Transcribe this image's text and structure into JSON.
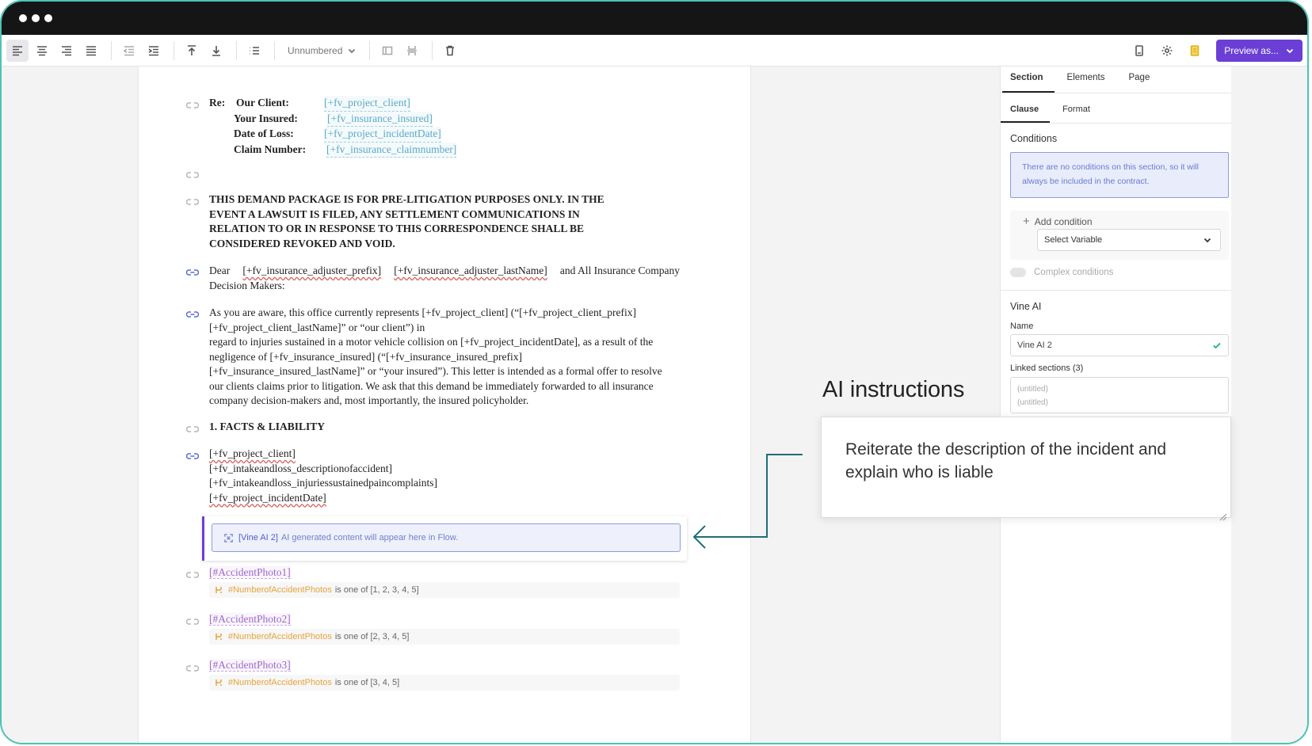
{
  "toolbar": {
    "numbering_label": "Unnumbered",
    "preview_label": "Preview as..."
  },
  "document": {
    "re": {
      "re_label": "Re:",
      "rows": [
        {
          "label": "Our Client:",
          "value": "[+fv_project_client]"
        },
        {
          "label": "Your Insured:",
          "value": "[+fv_insurance_insured]"
        },
        {
          "label": "Date of Loss:",
          "value": "[+fv_project_incidentDate]"
        },
        {
          "label": "Claim Number:",
          "value": "[+fv_insurance_claimnumber]"
        }
      ]
    },
    "disclaimer_lines": [
      "THIS DEMAND PACKAGE IS FOR PRE-LITIGATION PURPOSES ONLY. IN THE",
      "EVENT A LAWSUIT IS FILED, ANY SETTLEMENT COMMUNICATIONS IN",
      "RELATION TO OR IN RESPONSE TO THIS CORRESPONDENCE SHALL BE",
      "CONSIDERED REVOKED AND VOID."
    ],
    "dear": {
      "prefix": "Dear",
      "var1": "[+fv_insurance_adjuster_prefix]",
      "var2": "[+fv_insurance_adjuster_lastName]",
      "suffix": "and All Insurance Company",
      "line2": "Decision Makers:"
    },
    "aware_lines": [
      "As you are aware, this office currently represents [+fv_project_client] (“[+fv_project_client_prefix]",
      "[+fv_project_client_lastName]” or “our client”) in",
      "regard to injuries sustained in a motor vehicle collision on [+fv_project_incidentDate], as a result of the",
      "negligence of [+fv_insurance_insured] (“[+fv_insurance_insured_prefix]",
      "[+fv_insurance_insured_lastName]” or “your insured”). This letter is intended as a formal offer to resolve",
      "our clients claims prior to litigation. We ask that this demand be immediately forwarded to all insurance",
      "company decision-makers and, most importantly, the insured policyholder."
    ],
    "facts_heading": "1. FACTS & LIABILITY",
    "facts_vars": [
      "[+fv_project_client]",
      "[+fv_intakeandloss_descriptionofaccident]",
      "[+fv_intakeandloss_injuriessustainedpaincomplaints]",
      "[+fv_project_incidentDate]"
    ],
    "vine": {
      "tag": "[Vine AI 2]",
      "message": "AI generated content will appear here in Flow."
    },
    "photos": [
      {
        "var": "[#AccidentPhoto1]",
        "cond_var": "#NumberofAccidentPhotos",
        "cond_text": "is one of [1, 2, 3, 4, 5]"
      },
      {
        "var": "[#AccidentPhoto2]",
        "cond_var": "#NumberofAccidentPhotos",
        "cond_text": "is one of [2, 3, 4, 5]"
      },
      {
        "var": "[#AccidentPhoto3]",
        "cond_var": "#NumberofAccidentPhotos",
        "cond_text": "is one of [3, 4, 5]"
      }
    ]
  },
  "sidebar": {
    "tabs": [
      "Section",
      "Elements",
      "Page"
    ],
    "subtabs": [
      "Clause",
      "Format"
    ],
    "conditions_heading": "Conditions",
    "conditions_info": "There are no conditions on this section, so it will always be included in the contract.",
    "add_condition": "Add condition",
    "select_variable": "Select Variable",
    "complex_conditions": "Complex conditions",
    "vine_heading": "Vine AI",
    "name_label": "Name",
    "name_value": "Vine AI 2",
    "linked_label": "Linked sections (3)",
    "linked_items": [
      "(untitled)",
      "(untitled)"
    ]
  },
  "callout": {
    "title": "AI instructions",
    "text": "Reiterate the description of the incident and explain who is liable"
  },
  "colors": {
    "accent": "#6b3fd6",
    "frame": "#4cc3b5",
    "arrow": "#1f6d75"
  }
}
